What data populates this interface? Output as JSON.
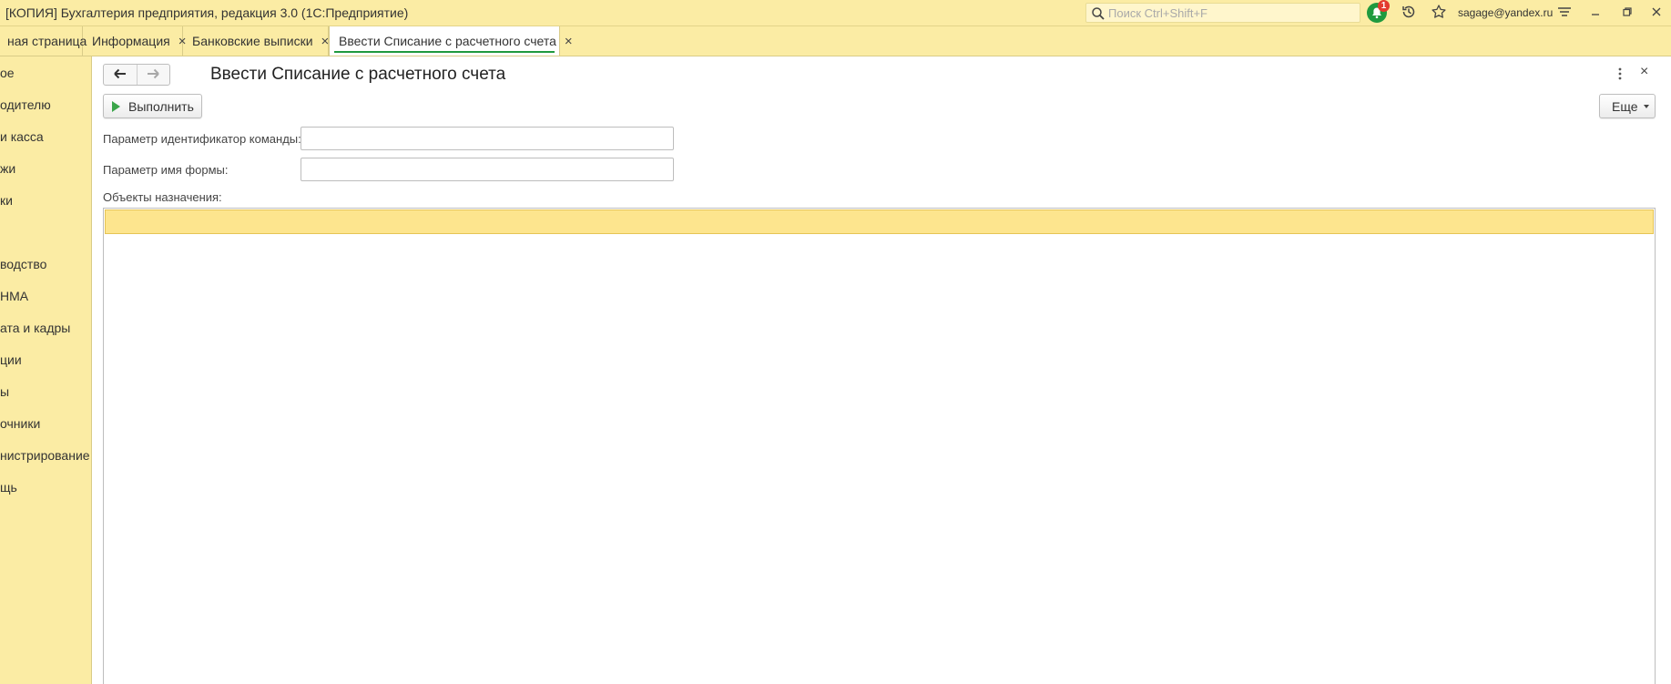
{
  "app": {
    "title": "[КОПИЯ] Бухгалтерия предприятия, редакция 3.0  (1С:Предприятие)",
    "search_placeholder": "Поиск Ctrl+Shift+F",
    "notification_count": "1",
    "user": "sagage@yandex.ru"
  },
  "tabs": [
    {
      "label": "ная страница"
    },
    {
      "label": "Информация",
      "close": "×"
    },
    {
      "label": "Банковские выписки",
      "close": "×"
    },
    {
      "label": "Ввести Списание с расчетного счета",
      "close": "×"
    }
  ],
  "sidebar": {
    "items": [
      {
        "label": "ое"
      },
      {
        "label": "одителю"
      },
      {
        "label": "и касса"
      },
      {
        "label": "жи"
      },
      {
        "label": "ки"
      },
      {
        "label": "водство"
      },
      {
        "label": "НМА"
      },
      {
        "label": "ата и кадры"
      },
      {
        "label": "ции"
      },
      {
        "label": "ы"
      },
      {
        "label": "очники"
      },
      {
        "label": "нистрирование"
      },
      {
        "label": "щь"
      }
    ]
  },
  "form": {
    "title": "Ввести Списание с расчетного счета",
    "close": "×",
    "execute_label": "Выполнить",
    "more_label": "Еще",
    "param_command_label": "Параметр идентификатор команды:",
    "param_command_value": "",
    "param_form_label": "Параметр имя формы:",
    "param_form_value": "",
    "objects_label": "Объекты назначения:"
  },
  "colors": {
    "panel_bg": "#fbeca4",
    "accent_green": "#1f9a3f",
    "selected_row": "#fde58e"
  }
}
